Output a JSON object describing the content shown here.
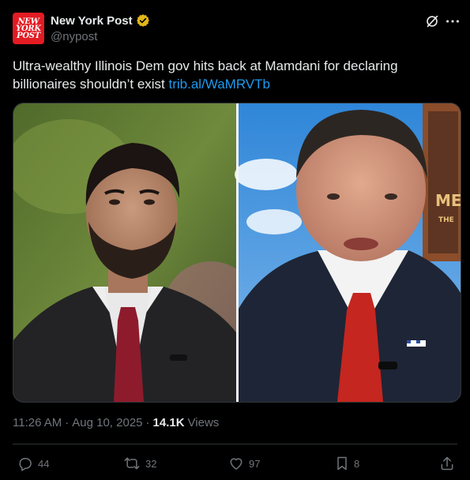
{
  "account": {
    "display_name": "New York Post",
    "handle": "@nypost",
    "avatar_lines": [
      "NEW",
      "YORK",
      "POST"
    ],
    "avatar_color": "#e31b23"
  },
  "icons": {
    "verified": "verified-gold-badge",
    "grok": "grok-icon",
    "more": "more-dots-icon",
    "reply": "reply-icon",
    "repost": "repost-icon",
    "like": "heart-icon",
    "bookmark": "bookmark-icon",
    "share": "share-icon"
  },
  "tweet": {
    "text": "Ultra-wealthy Illinois Dem gov hits back at Mamdani for declaring billionaires shouldn’t exist ",
    "link_text": "trib.al/WaMRVTb"
  },
  "media": {
    "panels": [
      "left-portrait",
      "right-portrait"
    ],
    "background_sign_text": [
      "ME",
      "THE"
    ]
  },
  "meta": {
    "time": "11:26 AM",
    "separator": "·",
    "date": "Aug 10, 2025",
    "separator2": "·",
    "views_count": "14.1K",
    "views_label": "Views"
  },
  "actions": {
    "replies": "44",
    "reposts": "32",
    "likes": "97",
    "bookmarks": "8"
  },
  "colors": {
    "background": "#000000",
    "text": "#e7e9ea",
    "muted": "#71767b",
    "link": "#1d9bf0",
    "verified": "#e2b719"
  }
}
